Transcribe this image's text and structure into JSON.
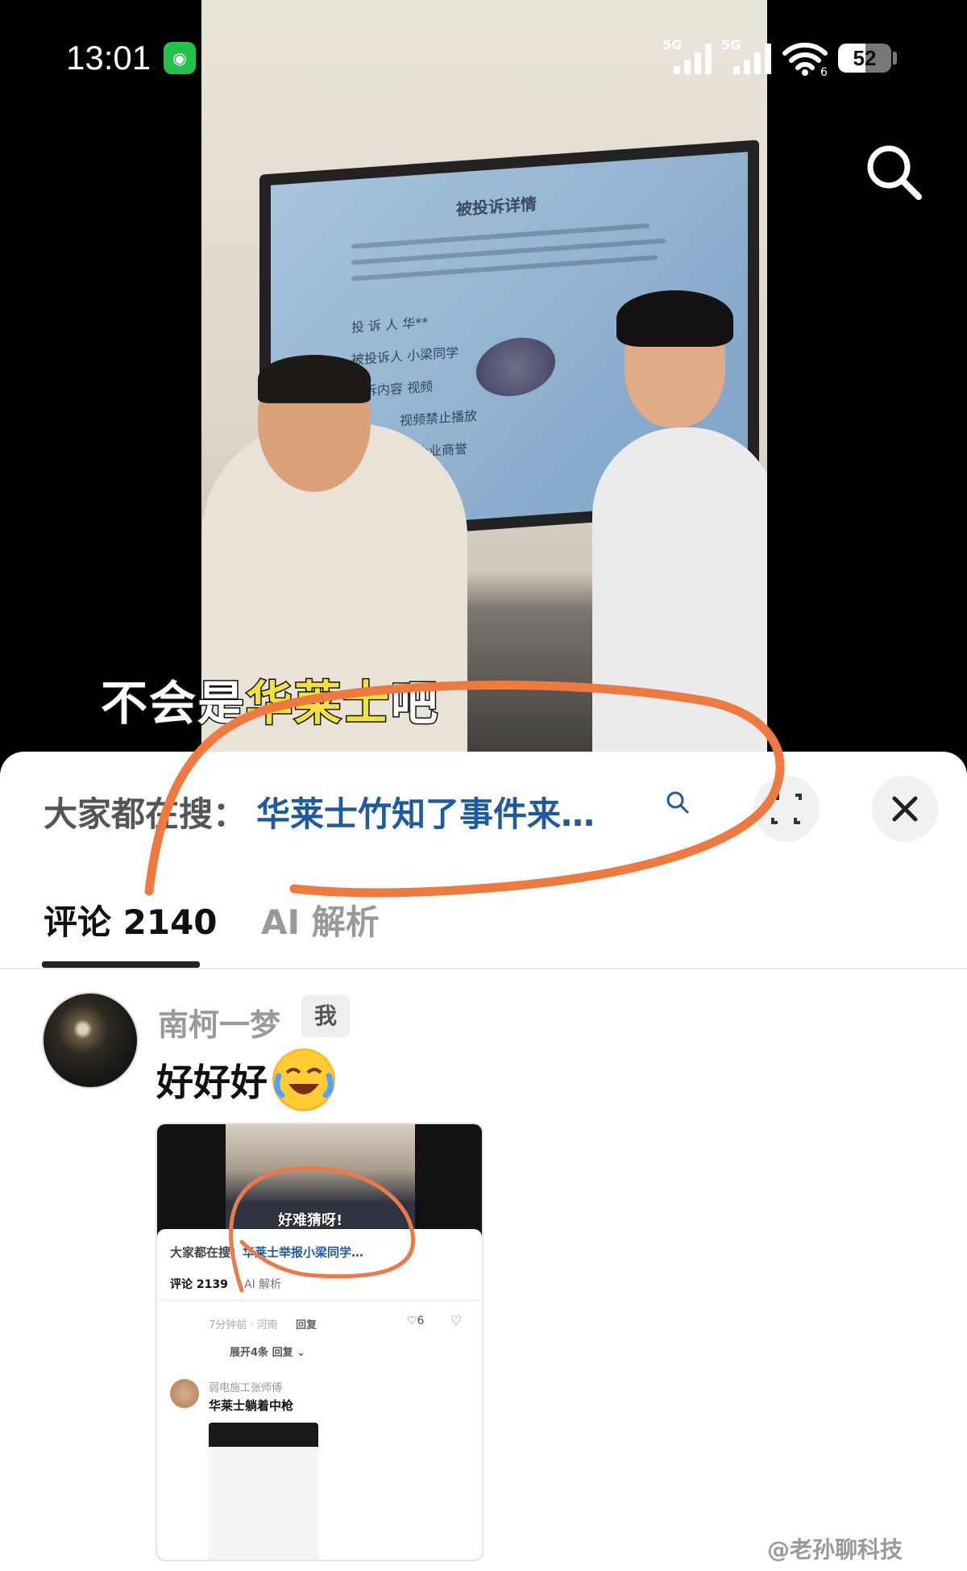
{
  "status_bar": {
    "time": "13:01",
    "wechat_icon": "wechat-icon",
    "sim1_label": "5G",
    "sim2_label": "5G",
    "wifi_label": "6",
    "battery": "52",
    "battery_level": 0.52
  },
  "video": {
    "subtitle_plain": "不会是",
    "subtitle_highlight": "华莱士",
    "subtitle_end": "吧",
    "tv_title": "被投诉详情",
    "tv_fields": [
      "投 诉 人  华**",
      "被投诉人  小梁同学",
      "投诉内容  视频",
      "视频禁止播放",
      "企业商誉"
    ]
  },
  "sheet": {
    "hot_search_prefix": "大家都在搜：",
    "hot_search_link": "华莱士竹知了事件来…",
    "tabs": [
      {
        "label": "评论 2140"
      },
      {
        "label": "AI 解析"
      }
    ]
  },
  "comment": {
    "username": "南柯一梦",
    "badge": "我",
    "text": "好好好",
    "emoji": "laughing-crying-emoji"
  },
  "embedded": {
    "subtitle": "好难猜呀!",
    "hot_prefix": "大家都在搜：",
    "hot_link": "华莱士举报小梁同学…",
    "tab1": "评论 2139",
    "tab2": "AI 解析",
    "meta": "7分钟前 · 河南",
    "reply": "回复",
    "likes": "♡6",
    "expand": "展开4条 回复 ⌄",
    "commenter_name": "弱电施工张师傅",
    "commenter_text": "华莱士躺着中枪"
  },
  "watermark": "@老孙聊科技",
  "colors": {
    "accent_link": "#1f5a9e",
    "annotation_orange": "#ef7a3f",
    "embedded_annotation_orange": "#ea7a4a"
  }
}
